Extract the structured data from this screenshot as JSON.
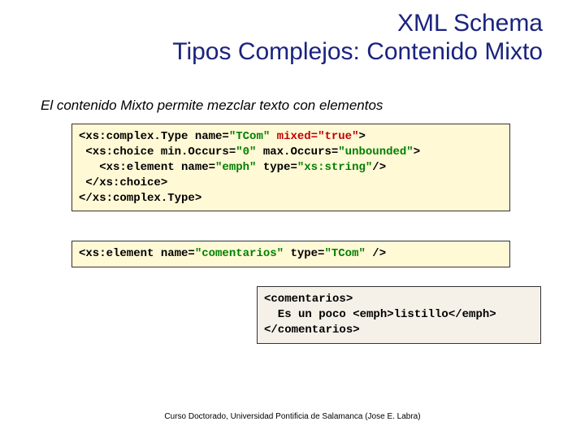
{
  "title": {
    "line1": "XML Schema",
    "line2": "Tipos Complejos: Contenido Mixto"
  },
  "intro": "El contenido Mixto permite mezclar texto con elementos",
  "code1": {
    "l1a": "<xs:complex.Type name=",
    "l1b": "\"TCom\"",
    "l1c": " ",
    "l1d": "mixed=\"true\"",
    "l1e": ">",
    "l2a": " <xs:choice min.Occurs=",
    "l2b": "\"0\"",
    "l2c": " max.Occurs=",
    "l2d": "\"unbounded\"",
    "l2e": ">",
    "l3a": "   <xs:element name=",
    "l3b": "\"emph\"",
    "l3c": " type=",
    "l3d": "\"xs:string\"",
    "l3e": "/>",
    "l4": " </xs:choice>",
    "l5": "</xs:complex.Type>"
  },
  "code2": {
    "l1a": "<xs:element name=",
    "l1b": "\"comentarios\"",
    "l1c": " type=",
    "l1d": "\"TCom\"",
    "l1e": " />"
  },
  "code3": {
    "l1": "<comentarios>",
    "l2": "  Es un poco <emph>listillo</emph>",
    "l3": "</comentarios>"
  },
  "footer": "Curso Doctorado, Universidad Pontificia de Salamanca (Jose E. Labra)"
}
